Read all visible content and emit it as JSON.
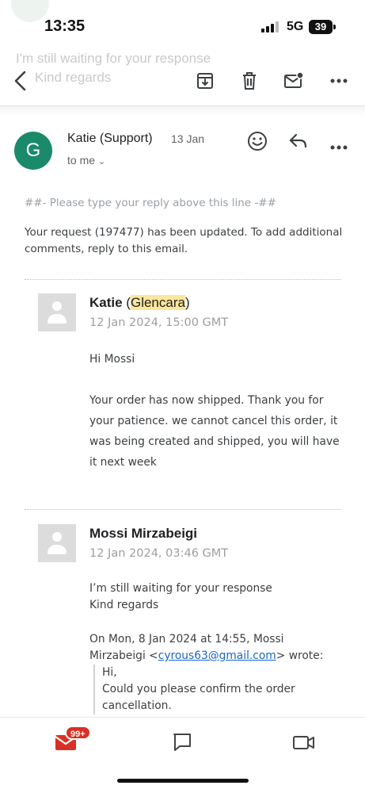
{
  "ghost": {
    "line1": "I'm still waiting for your response",
    "line2": "Kind regards"
  },
  "status": {
    "time": "13:35",
    "network": "5G",
    "battery": "39"
  },
  "toolbar": {
    "back": "back-icon",
    "archive": "archive-icon",
    "delete": "trash-icon",
    "mark_unread": "mail-unread-icon",
    "more": "more-icon"
  },
  "email": {
    "avatar_letter": "G",
    "sender": "Katie (Support)",
    "date": "13 Jan",
    "to": "to me",
    "hint": "##- Please type your reply above this line -##",
    "update": "Your request (197477) has been updated. To add additional comments, reply to this email."
  },
  "messages": [
    {
      "name": "Katie",
      "org_open": " (",
      "org": "Glencara",
      "org_close": ")",
      "date": "12 Jan 2024, 15:00 GMT",
      "greeting": "Hi Mossi",
      "body": "Your order has now shipped. Thank you for your patience. we cannot cancel this order, it was being created and shipped, you will have it next week"
    },
    {
      "name": "Mossi Mirzabeigi",
      "date": "12 Jan 2024, 03:46 GMT",
      "body_line1": "I’m still waiting for your response",
      "body_line2": "Kind regards",
      "quote_header_a": "On Mon, 8 Jan 2024 at 14:55, Mossi",
      "quote_header_b": "Mirzabeigi <",
      "quote_email": "cyrous63@gmail.com",
      "quote_header_c": "> wrote:",
      "quote_line1": "Hi,",
      "quote_line2": "Could you please confirm the order",
      "quote_line3": "cancellation."
    }
  ],
  "tabbar": {
    "mail_badge": "99+",
    "mail": "mail-icon",
    "chat": "chat-icon",
    "meet": "video-icon"
  },
  "colors": {
    "avatar": "#1a8a6b",
    "accent": "#d93025",
    "link": "#1a66c9",
    "highlight": "#fbe69a"
  }
}
